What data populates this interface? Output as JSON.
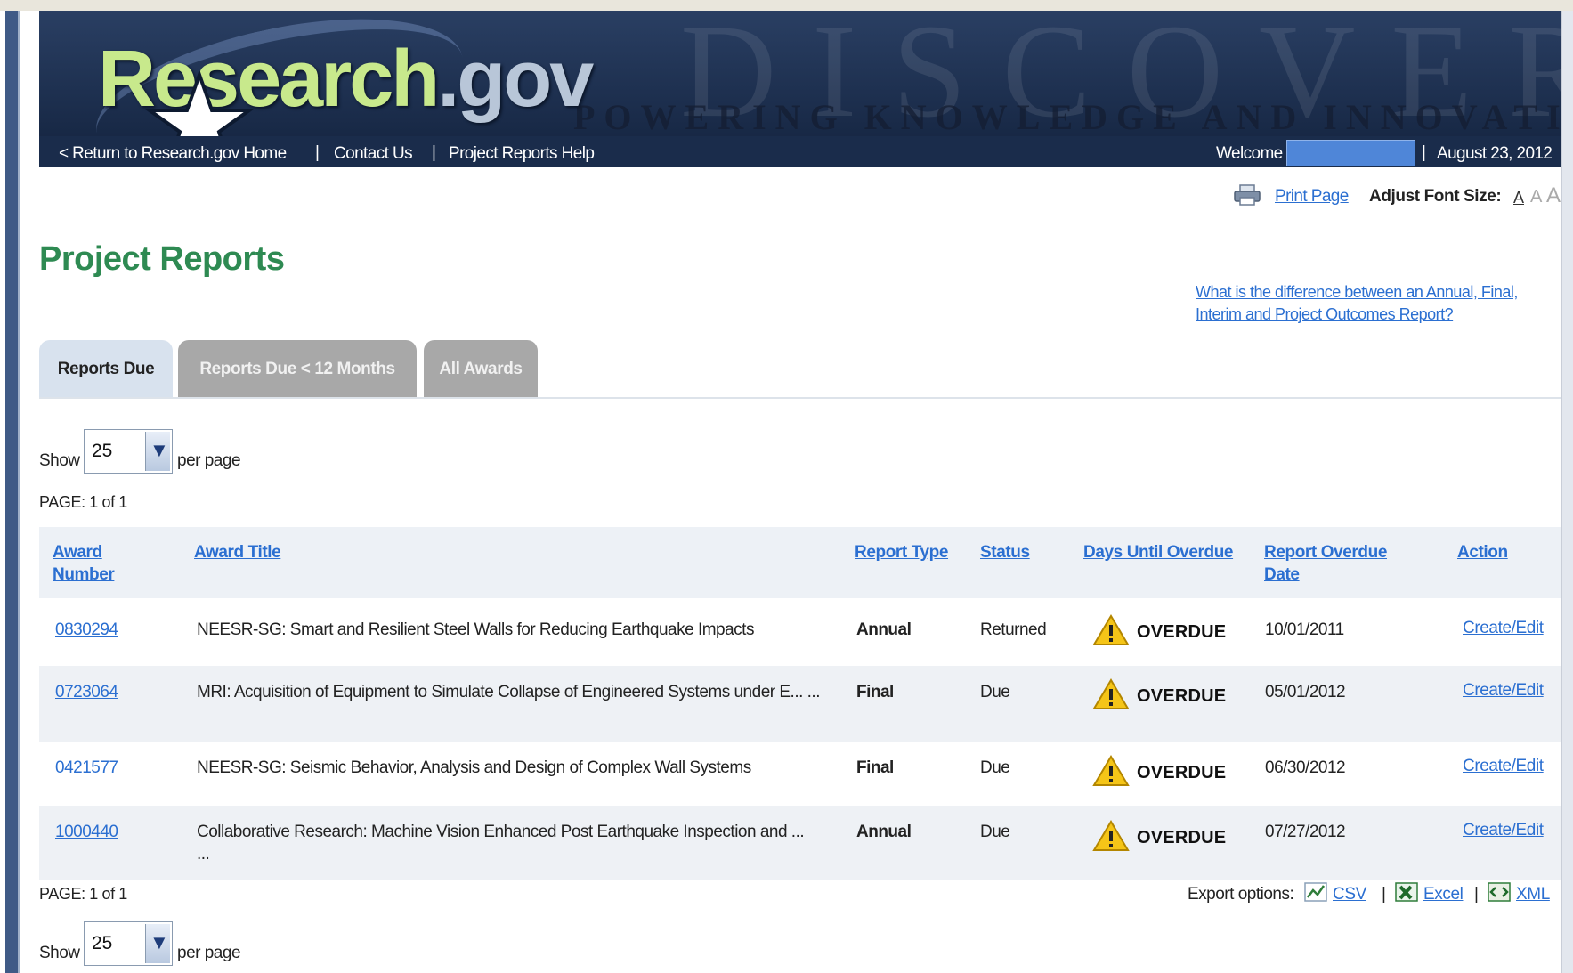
{
  "header": {
    "logo_main": "Research",
    "logo_suffix": ".gov",
    "tagline": "POWERING KNOWLEDGE AND INNOVATION",
    "watermark": "DISCOVERY",
    "nav": {
      "home": "< Return to Research.gov Home",
      "contact": "Contact Us",
      "help": "Project Reports Help"
    },
    "welcome": "Welcome",
    "date": "August 23, 2012"
  },
  "toolbar": {
    "print": "Print Page",
    "font_label": "Adjust Font Size:",
    "font_sizes": [
      "A",
      "A",
      "A"
    ]
  },
  "page_title": "Project Reports",
  "help_link": "What is the difference between an Annual, Final, Interim and Project Outcomes Report?",
  "tabs": [
    {
      "label": "Reports Due",
      "active": true
    },
    {
      "label": "Reports Due < 12 Months",
      "active": false
    },
    {
      "label": "All Awards",
      "active": false
    }
  ],
  "pagination": {
    "show_label": "Show",
    "per_page_value": "25",
    "per_page_label": "per page",
    "page_info": "PAGE: 1 of 1"
  },
  "table": {
    "columns": {
      "award_number": "Award Number",
      "award_title": "Award Title",
      "report_type": "Report Type",
      "status": "Status",
      "days_until_overdue": "Days Until Overdue",
      "report_overdue_date": "Report Overdue Date",
      "action": "Action"
    },
    "rows": [
      {
        "award_number": "0830294",
        "award_title": "NEESR-SG: Smart and Resilient Steel Walls for Reducing Earthquake Impacts",
        "report_type": "Annual",
        "status": "Returned",
        "days": "OVERDUE",
        "overdue_date": "10/01/2011",
        "action": "Create/Edit"
      },
      {
        "award_number": "0723064",
        "award_title": "MRI: Acquisition of Equipment to Simulate Collapse of Engineered Systems under E... ...",
        "report_type": "Final",
        "status": "Due",
        "days": "OVERDUE",
        "overdue_date": "05/01/2012",
        "action": "Create/Edit"
      },
      {
        "award_number": "0421577",
        "award_title": "NEESR-SG: Seismic Behavior, Analysis and Design of Complex Wall Systems",
        "report_type": "Final",
        "status": "Due",
        "days": "OVERDUE",
        "overdue_date": "06/30/2012",
        "action": "Create/Edit"
      },
      {
        "award_number": "1000440",
        "award_title": "Collaborative Research: Machine Vision Enhanced Post Earthquake Inspection and ... ...",
        "report_type": "Annual",
        "status": "Due",
        "days": "OVERDUE",
        "overdue_date": "07/27/2012",
        "action": "Create/Edit"
      }
    ]
  },
  "export": {
    "label": "Export options:",
    "csv": "CSV",
    "excel": "Excel",
    "xml": "XML"
  },
  "colors": {
    "header_bg": "#1c2e4d",
    "logo_green": "#c8e98c",
    "title_green": "#2e8a52",
    "link_blue": "#2b6fd1",
    "warning_yellow": "#f5c518"
  }
}
